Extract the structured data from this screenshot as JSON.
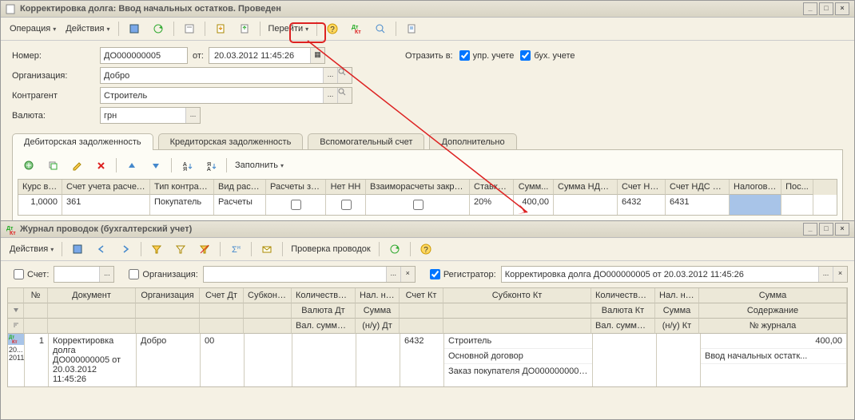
{
  "win1": {
    "title": "Корректировка долга: Ввод начальных остатков. Проведен",
    "toolbar": {
      "op": "Операция",
      "act": "Действия",
      "go": "Перейти"
    },
    "fields": {
      "number_lbl": "Номер:",
      "number_val": "ДО000000005",
      "ot": "от:",
      "date_val": "20.03.2012 11:45:26",
      "reflect_lbl": "Отразить в:",
      "chk1": "упр. учете",
      "chk2": "бух. учете",
      "org_lbl": "Организация:",
      "org_val": "Добро",
      "ctr_lbl": "Контрагент",
      "ctr_val": "Строитель",
      "cur_lbl": "Валюта:",
      "cur_val": "грн"
    },
    "tabs": {
      "t1": "Дебиторская задолженность",
      "t2": "Кредиторская задолженность",
      "t3": "Вспомогательный счет",
      "t4": "Дополнительно"
    },
    "fill": "Заполнить",
    "cols": [
      "Курс вз...",
      "Счет учета расчетов",
      "Тип контраге...",
      "Вид расч...",
      "Расчеты за...",
      "Нет НН",
      "Взаиморасчеты закрыты",
      "Ставка ...",
      "Сумм...",
      "Сумма НДС (...",
      "Счет НД...",
      "Счет НДС кр...",
      "Налогово...",
      "Пос..."
    ],
    "row": {
      "kurs": "1,0000",
      "schet": "361",
      "tip": "Покупатель",
      "vid": "Расчеты",
      "stavka": "20%",
      "summa": "400,00",
      "schetnd": "6432",
      "schetndkr": "6431"
    }
  },
  "win2": {
    "title": "Журнал проводок (бухгалтерский учет)",
    "toolbar": {
      "act": "Действия",
      "chk": "Проверка проводок"
    },
    "filter": {
      "schet": "Счет:",
      "org": "Организация:",
      "reg": "Регистратор:",
      "reg_val": "Корректировка долга ДО000000005 от 20.03.2012 11:45:26"
    },
    "head": {
      "r1": [
        "№",
        "Документ",
        "Организация",
        "Счет Дт",
        "Субконт...",
        "Количество ...",
        "Нал. на...",
        "Счет Кт",
        "Субконто Кт",
        "Количество ...",
        "Нал. на...",
        "Сумма"
      ],
      "r2": [
        "",
        "",
        "",
        "",
        "",
        "Валюта Дт",
        "Сумма",
        "",
        "",
        "Валюта Кт",
        "Сумма",
        "Содержание"
      ],
      "r3": [
        "",
        "",
        "",
        "",
        "",
        "Вал. сумма Дт",
        "(н/у) Дт",
        "",
        "",
        "Вал. сумма Кт",
        "(н/у) Кт",
        "№ журнала"
      ]
    },
    "row": {
      "n": "1",
      "date": "20...\n2011",
      "doc": "Корректировка долга ДО000000005 от 20.03.2012 11:45:26",
      "org": "Добро",
      "dt": "00",
      "kt": "6432",
      "sub1": "Строитель",
      "sub2": "Основной договор",
      "sub3": "Заказ покупателя ДО0000000006...",
      "sum": "400,00",
      "cont": "Ввод начальных остатк..."
    }
  }
}
